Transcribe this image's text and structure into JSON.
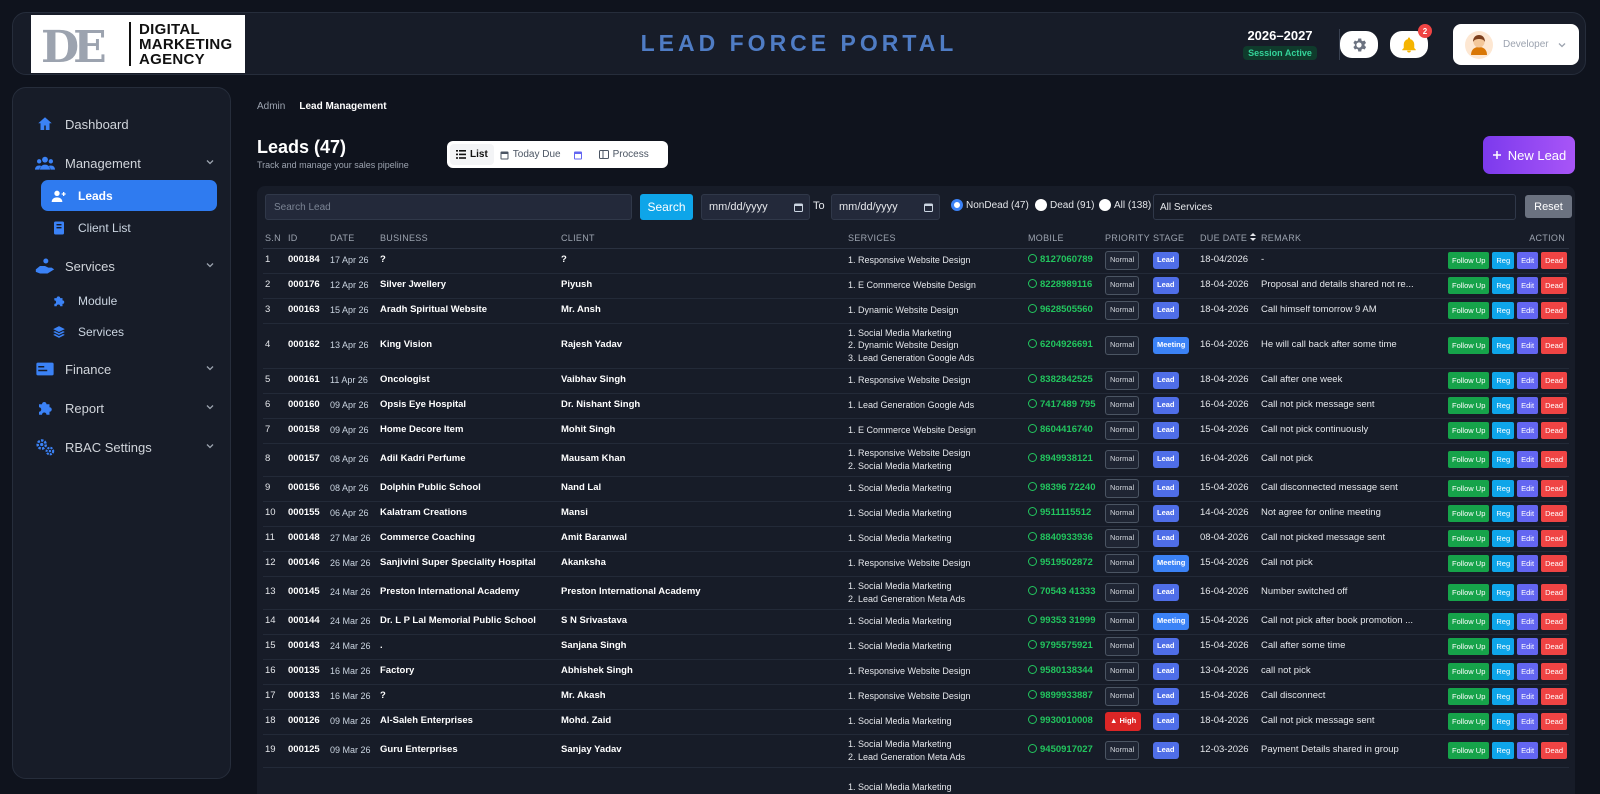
{
  "app": {
    "logo_line1": "DIGITAL",
    "logo_line2": "MARKETING",
    "logo_line3": "AGENCY",
    "logo_mark": "DE",
    "portal_title": "LEAD FORCE PORTAL",
    "session_year": "2026–2027",
    "session_status": "Session Active",
    "notification_count": "2",
    "user_name": "Developer"
  },
  "sidebar": {
    "items": [
      {
        "label": "Dashboard",
        "icon": "home-icon"
      },
      {
        "label": "Management",
        "icon": "users-group-icon"
      },
      {
        "label": "Leads",
        "icon": "user-plus-icon"
      },
      {
        "label": "Client List",
        "icon": "contact-book-icon"
      },
      {
        "label": "Services",
        "icon": "hand-service-icon"
      },
      {
        "label": "Module",
        "icon": "puzzle-icon"
      },
      {
        "label": "Services",
        "icon": "layers-icon"
      },
      {
        "label": "Finance",
        "icon": "finance-card-icon"
      },
      {
        "label": "Report",
        "icon": "puzzle-icon"
      },
      {
        "label": "RBAC Settings",
        "icon": "gears-icon"
      }
    ]
  },
  "breadcrumb": {
    "root": "Admin",
    "current": "Lead Management"
  },
  "page": {
    "title": "Leads (47)",
    "subtitle": "Track and manage your sales pipeline",
    "view_list": "List",
    "view_today": "Today Due",
    "view_process": "Process",
    "new_lead": "New Lead"
  },
  "filters": {
    "search_placeholder": "Search Lead",
    "search_btn": "Search",
    "date_from": "mm/dd/yyyy",
    "to_label": "To",
    "date_to": "mm/dd/yyyy",
    "radio_nondead": "NonDead (47)",
    "radio_dead": "Dead (91)",
    "radio_all": "All (138)",
    "services": "All Services",
    "reset": "Reset"
  },
  "table": {
    "headers": [
      "S.N",
      "ID",
      "DATE",
      "BUSINESS",
      "CLIENT",
      "SERVICES",
      "MOBILE",
      "PRIORITY",
      "STAGE",
      "DUE DATE",
      "REMARK",
      "ACTION"
    ],
    "actions": {
      "follow": "Follow Up",
      "reg": "Reg",
      "edit": "Edit",
      "dead": "Dead"
    },
    "rows": [
      {
        "sn": "1",
        "id": "000184",
        "date": "17 Apr 26",
        "business": "?",
        "client": "?",
        "services": [
          "1. Responsive Website Design"
        ],
        "mobile": "8127060789",
        "priority": "Normal",
        "stage": "Lead",
        "due": "18-04/2026",
        "remark": "-"
      },
      {
        "sn": "2",
        "id": "000176",
        "date": "12 Apr 26",
        "business": "Silver Jwellery",
        "client": "Piyush",
        "services": [
          "1. E Commerce Website Design"
        ],
        "mobile": "8228989116",
        "priority": "Normal",
        "stage": "Lead",
        "due": "18-04-2026",
        "remark": "Proposal and details shared not re..."
      },
      {
        "sn": "3",
        "id": "000163",
        "date": "15 Apr 26",
        "business": "Aradh Spiritual Website",
        "client": "Mr. Ansh",
        "services": [
          "1. Dynamic Website Design"
        ],
        "mobile": "9628505560",
        "priority": "Normal",
        "stage": "Lead",
        "due": "18-04-2026",
        "remark": "Call himself tomorrow 9 AM"
      },
      {
        "sn": "4",
        "id": "000162",
        "date": "13 Apr 26",
        "business": "King Vision",
        "client": "Rajesh Yadav",
        "services": [
          "1. Social Media Marketing",
          "2. Dynamic Website Design",
          "3. Lead Generation Google Ads"
        ],
        "mobile": "6204926691",
        "priority": "Normal",
        "stage": "Meeting",
        "due": "16-04-2026",
        "remark": "He will call back after some time"
      },
      {
        "sn": "5",
        "id": "000161",
        "date": "11 Apr 26",
        "business": "Oncologist",
        "client": "Vaibhav Singh",
        "services": [
          "1. Responsive Website Design"
        ],
        "mobile": "8382842525",
        "priority": "Normal",
        "stage": "Lead",
        "due": "18-04-2026",
        "remark": "Call after one week"
      },
      {
        "sn": "6",
        "id": "000160",
        "date": "09 Apr 26",
        "business": "Opsis Eye Hospital",
        "client": "Dr. Nishant Singh",
        "services": [
          "1. Lead Generation Google Ads"
        ],
        "mobile": "7417489 795",
        "priority": "Normal",
        "stage": "Lead",
        "due": "16-04-2026",
        "remark": "Call not pick message sent"
      },
      {
        "sn": "7",
        "id": "000158",
        "date": "09 Apr 26",
        "business": "Home Decore Item",
        "client": "Mohit Singh",
        "services": [
          "1. E Commerce Website Design"
        ],
        "mobile": "8604416740",
        "priority": "Normal",
        "stage": "Lead",
        "due": "15-04-2026",
        "remark": "Call not pick continuously"
      },
      {
        "sn": "8",
        "id": "000157",
        "date": "08 Apr 26",
        "business": "Adil Kadri Perfume",
        "client": "Mausam Khan",
        "services": [
          "1. Responsive Website Design",
          "2. Social Media Marketing"
        ],
        "mobile": "8949938121",
        "priority": "Normal",
        "stage": "Lead",
        "due": "16-04-2026",
        "remark": "Call not pick"
      },
      {
        "sn": "9",
        "id": "000156",
        "date": "08 Apr 26",
        "business": "Dolphin Public School",
        "client": "Nand Lal",
        "services": [
          "1. Social Media Marketing"
        ],
        "mobile": "98396 72240",
        "priority": "Normal",
        "stage": "Lead",
        "due": "15-04-2026",
        "remark": "Call disconnected message sent"
      },
      {
        "sn": "10",
        "id": "000155",
        "date": "06 Apr 26",
        "business": "Kalatram Creations",
        "client": "Mansi",
        "services": [
          "1. Social Media Marketing"
        ],
        "mobile": "9511115512",
        "priority": "Normal",
        "stage": "Lead",
        "due": "14-04-2026",
        "remark": "Not agree for online meeting"
      },
      {
        "sn": "11",
        "id": "000148",
        "date": "27 Mar 26",
        "business": "Commerce Coaching",
        "client": "Amit Baranwal",
        "services": [
          "1. Social Media Marketing"
        ],
        "mobile": "8840933936",
        "priority": "Normal",
        "stage": "Lead",
        "due": "08-04-2026",
        "remark": "Call not picked message sent"
      },
      {
        "sn": "12",
        "id": "000146",
        "date": "26 Mar 26",
        "business": "Sanjivini Super Speciality Hospital",
        "client": "Akanksha",
        "services": [
          "1. Responsive Website Design"
        ],
        "mobile": "9519502872",
        "priority": "Normal",
        "stage": "Meeting",
        "due": "15-04-2026",
        "remark": "Call not pick"
      },
      {
        "sn": "13",
        "id": "000145",
        "date": "24 Mar 26",
        "business": "Preston International Academy",
        "client": "Preston International Academy",
        "services": [
          "1. Social Media Marketing",
          "2. Lead Generation Meta Ads"
        ],
        "mobile": "70543 41333",
        "priority": "Normal",
        "stage": "Lead",
        "due": "16-04-2026",
        "remark": "Number switched off"
      },
      {
        "sn": "14",
        "id": "000144",
        "date": "24 Mar 26",
        "business": "Dr. L P Lal Memorial Public School",
        "client": "S N Srivastava",
        "services": [
          "1. Social Media Marketing"
        ],
        "mobile": "99353 31999",
        "priority": "Normal",
        "stage": "Meeting",
        "due": "15-04-2026",
        "remark": "Call not pick after book promotion ..."
      },
      {
        "sn": "15",
        "id": "000143",
        "date": "24 Mar 26",
        "business": ".",
        "client": "Sanjana Singh",
        "services": [
          "1. Social Media Marketing"
        ],
        "mobile": "9795575921",
        "priority": "Normal",
        "stage": "Lead",
        "due": "15-04-2026",
        "remark": "Call after some time"
      },
      {
        "sn": "16",
        "id": "000135",
        "date": "16 Mar 26",
        "business": "Factory",
        "client": "Abhishek Singh",
        "services": [
          "1. Responsive Website Design"
        ],
        "mobile": "9580138344",
        "priority": "Normal",
        "stage": "Lead",
        "due": "13-04-2026",
        "remark": "call not pick"
      },
      {
        "sn": "17",
        "id": "000133",
        "date": "16 Mar 26",
        "business": "?",
        "client": "Mr. Akash",
        "services": [
          "1. Responsive Website Design"
        ],
        "mobile": "9899933887",
        "priority": "Normal",
        "stage": "Lead",
        "due": "15-04-2026",
        "remark": "Call disconnect"
      },
      {
        "sn": "18",
        "id": "000126",
        "date": "09 Mar 26",
        "business": "Al-Saleh Enterprises",
        "client": "Mohd. Zaid",
        "services": [
          "1. Social Media Marketing"
        ],
        "mobile": "9930010008",
        "priority": "High",
        "stage": "Lead",
        "due": "18-04-2026",
        "remark": "Call not pick message sent"
      },
      {
        "sn": "19",
        "id": "000125",
        "date": "09 Mar 26",
        "business": "Guru Enterprises",
        "client": "Sanjay Yadav",
        "services": [
          "1. Social Media Marketing",
          "2. Lead Generation Meta Ads"
        ],
        "mobile": "9450917027",
        "priority": "Normal",
        "stage": "Lead",
        "due": "12-03-2026",
        "remark": "Payment Details shared in group"
      },
      {
        "sn": "",
        "id": "",
        "date": "",
        "business": "",
        "client": "",
        "services": [
          "1. Social Media Marketing"
        ],
        "mobile": "",
        "priority": "",
        "stage": "",
        "due": "",
        "remark": ""
      }
    ]
  }
}
